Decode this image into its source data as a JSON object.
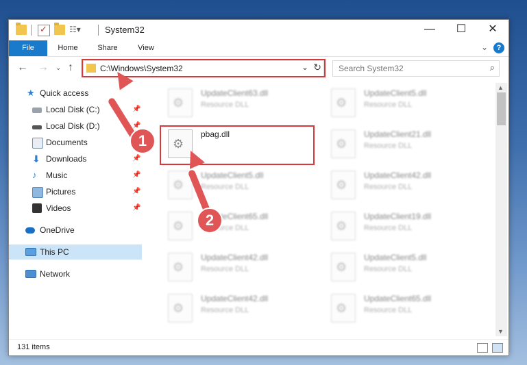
{
  "window": {
    "title": "System32",
    "caption_minimize": "—",
    "caption_maximize": "☐",
    "caption_close": "✕"
  },
  "ribbon": {
    "tabs": [
      "File",
      "Home",
      "Share",
      "View"
    ]
  },
  "address": {
    "path": "C:\\Windows\\System32",
    "search_placeholder": "Search System32"
  },
  "nav": {
    "items": [
      {
        "label": "Quick access",
        "icon": "star-icon",
        "pinned": false
      },
      {
        "label": "Local Disk (C:)",
        "icon": "drive-icon",
        "pinned": true
      },
      {
        "label": "Local Disk (D:)",
        "icon": "drive-icon",
        "pinned": true
      },
      {
        "label": "Documents",
        "icon": "documents-icon",
        "pinned": true
      },
      {
        "label": "Downloads",
        "icon": "downloads-icon",
        "pinned": true
      },
      {
        "label": "Music",
        "icon": "music-icon",
        "pinned": true
      },
      {
        "label": "Pictures",
        "icon": "pictures-icon",
        "pinned": true
      },
      {
        "label": "Videos",
        "icon": "videos-icon",
        "pinned": true
      },
      {
        "label": "OneDrive",
        "icon": "onedrive-icon",
        "pinned": false
      },
      {
        "label": "This PC",
        "icon": "pc-icon",
        "pinned": false,
        "selected": true
      },
      {
        "label": "Network",
        "icon": "network-icon",
        "pinned": false
      }
    ]
  },
  "files": [
    {
      "name": "UpdateClient63.dll",
      "type": "Resource DLL"
    },
    {
      "name": "UpdateClient5.dll",
      "type": "Resource DLL"
    },
    {
      "name": "pbag.dll",
      "type": ""
    },
    {
      "name": "UpdateClient21.dll",
      "type": "Resource DLL"
    },
    {
      "name": "UpdateClient5.dll",
      "type": "Resource DLL"
    },
    {
      "name": "UpdateClient42.dll",
      "type": "Resource DLL"
    },
    {
      "name": "UpdateClient65.dll",
      "type": "Resource DLL"
    },
    {
      "name": "UpdateClient19.dll",
      "type": "Resource DLL"
    },
    {
      "name": "UpdateClient42.dll",
      "type": "Resource DLL"
    },
    {
      "name": "UpdateClient5.dll",
      "type": "Resource DLL"
    },
    {
      "name": "UpdateClient42.dll",
      "type": "Resource DLL"
    },
    {
      "name": "UpdateClient65.dll",
      "type": "Resource DLL"
    }
  ],
  "status": {
    "item_count": "131 items"
  },
  "callouts": {
    "step1": "1",
    "step2": "2"
  },
  "colors": {
    "accent": "#1979ca",
    "highlight": "#d9383a",
    "callout": "#e05555"
  }
}
